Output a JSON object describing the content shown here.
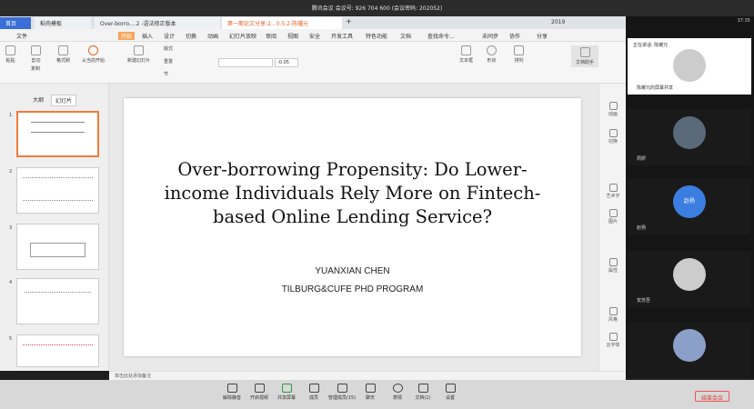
{
  "meeting": {
    "info": "腾讯会议 会议号: 926 704 600  (会议密码: 202052)"
  },
  "clock": "37:35",
  "tabs": [
    {
      "label": "首页"
    },
    {
      "label": "稻壳模板"
    },
    {
      "label": "Over-borro....2 -语法修正版本"
    },
    {
      "label": "第一期论文分享-2...0.5.2-陈耀元"
    },
    {
      "label": "+"
    },
    {
      "label": "2019"
    }
  ],
  "menu": [
    "文件",
    "开始",
    "插入",
    "设计",
    "切换",
    "动画",
    "幻灯片放映",
    "审阅",
    "视图",
    "安全",
    "开发工具",
    "特色功能",
    "文档",
    "查找命令..."
  ],
  "menu_right": [
    "未同步",
    "协作",
    "分享"
  ],
  "ribbon": {
    "font_size_value": "-0.05",
    "buttons": [
      "粘贴",
      "剪切",
      "复制",
      "格式刷",
      "从当前开始",
      "新建幻灯片",
      "版式",
      "重置",
      "节",
      "文本框",
      "形状",
      "排列",
      "文档助手"
    ]
  },
  "left_panel": {
    "tabs": [
      "大纲",
      "幻灯片"
    ],
    "thumb_numbers": [
      "1",
      "2",
      "3",
      "4",
      "5"
    ]
  },
  "slide": {
    "title": "Over-borrowing Propensity: Do Lower-income Individuals Rely More on Fintech-based Online Lending Service?",
    "author": "YUANXIAN CHEN",
    "program": "TILBURG&CUFE PHD PROGRAM"
  },
  "notes_placeholder": "单击此处添加备注",
  "right_tools": [
    "动画",
    "切换",
    "艺术字",
    "图片",
    "属性",
    "风格",
    "云字体"
  ],
  "video": {
    "speaking_label": "正在讲话: 陈耀元",
    "tiles": [
      {
        "name": "陈耀元的屏幕共享"
      },
      {
        "name": "周妍"
      },
      {
        "name": "赵杨"
      },
      {
        "name": "安苏吾"
      },
      {
        "name": ""
      }
    ],
    "zhao_text": "赵杨"
  },
  "bottom_bar": {
    "buttons": [
      "解除静音",
      "开启视频",
      "共享屏幕",
      "成员",
      "管理成员(15)",
      "聊天",
      "表情",
      "文档(1)",
      "设置"
    ],
    "leave_label": "结束会议"
  }
}
